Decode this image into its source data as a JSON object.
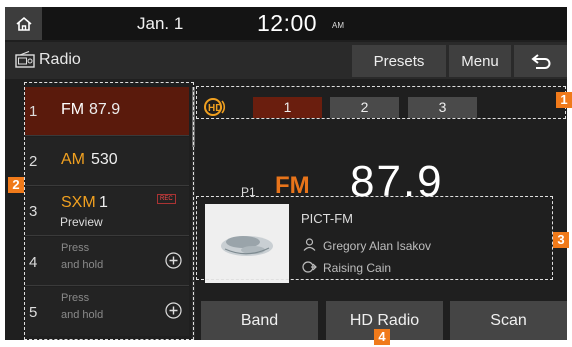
{
  "status_bar": {
    "date": "Jan.  1",
    "time": "12:00",
    "ampm": "AM",
    "home_icon": "home-icon"
  },
  "title_bar": {
    "title": "Radio",
    "presets_label": "Presets",
    "menu_label": "Menu",
    "back_icon": "back-arrow-icon"
  },
  "presets": [
    {
      "num": "1",
      "band": "FM",
      "freq": "87.9"
    },
    {
      "num": "2",
      "band": "AM",
      "freq": "530"
    },
    {
      "num": "3",
      "band": "SXM",
      "freq": "1",
      "sub": "Preview",
      "rec": "REC"
    },
    {
      "num": "4",
      "line1": "Press",
      "line2": "and hold"
    },
    {
      "num": "5",
      "line1": "Press",
      "line2": "and hold"
    }
  ],
  "hd": {
    "channels": [
      "1",
      "2",
      "3"
    ],
    "active": "1"
  },
  "now_playing": {
    "preset": "P1",
    "band": "FM",
    "frequency": "87.9",
    "station": "PICT-FM",
    "artist": "Gregory Alan Isakov",
    "song": "Raising Cain"
  },
  "bottom_buttons": {
    "band": "Band",
    "hd_radio": "HD Radio",
    "scan": "Scan"
  },
  "callouts": [
    "1",
    "2",
    "3",
    "4"
  ],
  "colors": {
    "accent": "#e8741a",
    "active_preset": "#5a1a0c",
    "callout": "#f07a1a"
  }
}
